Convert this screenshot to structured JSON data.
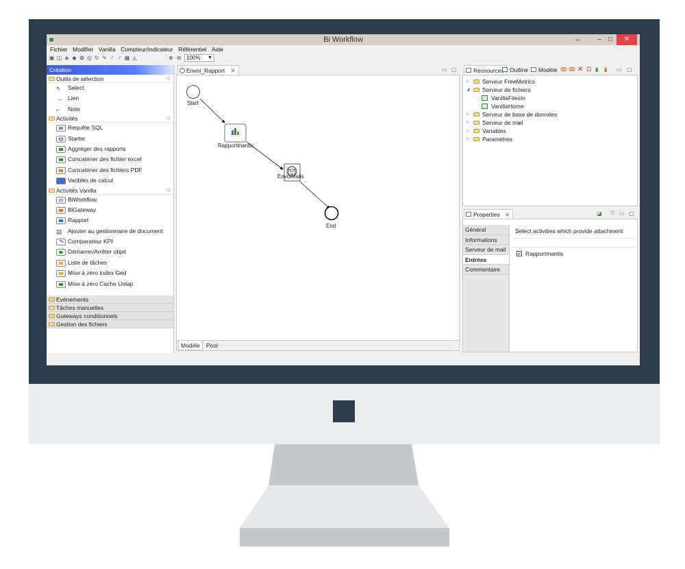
{
  "window": {
    "title": "Bi Workflow",
    "controls": {
      "restore": "↔",
      "minimize": "–",
      "maximize": "□",
      "close": "✕"
    }
  },
  "menu": [
    "Fichier",
    "Modifier",
    "Vanilla",
    "Compteur/indicateur",
    "Référentiel",
    "Aide"
  ],
  "toolbar": {
    "zoom": "100%"
  },
  "palette": {
    "header": "Création",
    "drawers": {
      "tools": {
        "label": "Outils de sélection",
        "items": [
          "Select",
          "Lien",
          "Note"
        ]
      },
      "activities": {
        "label": "Activités",
        "items": [
          "Requête SQL",
          "Starter",
          "Aggréger des rapports",
          "Concaténer des fichier excel",
          "Concaténer des fichiers PDF",
          "Varibles de calcul"
        ]
      },
      "vanilla": {
        "label": "Activités Vanilla",
        "items": [
          "BiWorkflow",
          "BiGateway",
          "Rapport",
          "Ajouter au gestionnaire de document",
          "Comparateur KPI",
          "Démarrer/Arrêter objet",
          "Liste de tâches",
          "Mise à zéro Index Ged",
          "Mise à zéro Cache Uolap"
        ]
      },
      "closed": [
        "Evénements",
        "Tâches manuelles",
        "Gateways conditionnels",
        "Gestion des fichiers"
      ]
    }
  },
  "editor": {
    "tab": "Envoi_Rapport",
    "close_glyph": "✕",
    "nodes": {
      "start": "Start",
      "report": "Rapportmantis",
      "mail": "EnvoiMails",
      "end": "End"
    },
    "bottom_tabs": [
      "Modèle",
      "Pool"
    ]
  },
  "resources": {
    "tabs": [
      "Ressources",
      "Outline",
      "Modèle"
    ],
    "tree": {
      "freemetrics": "Serveur FreeMetrics",
      "files": "Serveur de fichiers",
      "files_in": "VanillaFilesIn",
      "home": "VanillaHome",
      "db": "Serveur de base de données",
      "mail": "Serveur de mail",
      "vars": "Variables",
      "params": "Paramètres"
    }
  },
  "properties": {
    "tab": "Properties",
    "tabs": [
      "Général",
      "Informations",
      "Serveur de mail",
      "Entrées",
      "Commentaire"
    ],
    "description": "Select activities which provide attachment",
    "checkbox_label": "Rapportmantis",
    "checkbox_mark": "✓"
  },
  "colors": {
    "bezel": "#2e3b4a",
    "accent": "#3f5cd8",
    "close": "#e04343"
  }
}
